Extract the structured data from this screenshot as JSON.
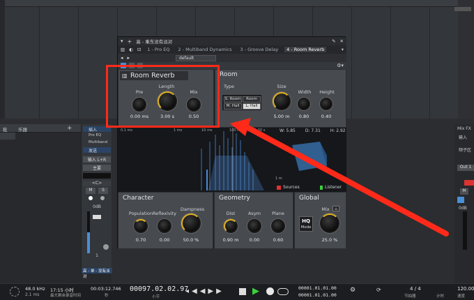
{
  "daw": {
    "tracks_header": "乐器",
    "track_left_label": "批",
    "track_name_strip": "高 - 单 - 没有派对",
    "plus_symbol": "+",
    "mixer_strip": {
      "inserts_label": "插入",
      "insert_items": [
        "Pro EQ",
        "Multiband"
      ],
      "sends_label": "发送",
      "input_label": "输入 L+R",
      "output_label": "主要",
      "pan_label": "<C>",
      "mute": "M",
      "solo": "S",
      "volume": "0dB",
      "channel_number": "1"
    },
    "right_strip": {
      "header": "Mix FX",
      "inserts_label": "输入",
      "group_label": "频子区",
      "out_label": "Out 1",
      "volume": "0dB",
      "mute": "M"
    }
  },
  "plugin": {
    "title": "高 - 乘东没有派对",
    "tabs": [
      "1 - Pro EQ",
      "2 - Multiband Dynamics",
      "3 - Groove Delay",
      "4 - Room Reverb"
    ],
    "active_tab": 3,
    "preset": "default",
    "room_reverb": {
      "name": "Room Reverb",
      "knobs": [
        {
          "label": "Pre",
          "value": "0.00 ms"
        },
        {
          "label": "Length",
          "value": "3.00 s"
        },
        {
          "label": "Mix",
          "value": "0.50"
        }
      ]
    },
    "room": {
      "title": "Room",
      "type_label": "Type",
      "types": [
        "S. Room",
        "Room",
        "M. Hall",
        "L. Hall"
      ],
      "active_type": "L. Hall",
      "knobs": [
        {
          "label": "Size",
          "value": "5.00 m"
        },
        {
          "label": "Width",
          "value": "0.80"
        },
        {
          "label": "Height",
          "value": "0.40"
        }
      ]
    },
    "viz": {
      "time_marks": [
        "0.1 ms",
        "1 ms",
        "10 ms",
        "100 ms",
        "1.00 s"
      ],
      "dims": [
        "W: 5.85",
        "D: 7.31",
        "H: 2.92"
      ],
      "sources_label": "Sources",
      "listener_label": "Listener",
      "distance_marker": "1 m"
    },
    "character": {
      "title": "Character",
      "knobs": [
        {
          "label": "Population",
          "value": "0.70"
        },
        {
          "label": "Reflexivity",
          "value": "0.00"
        },
        {
          "label": "Dampness",
          "value": "50.0 %"
        }
      ]
    },
    "geometry": {
      "title": "Geometry",
      "knobs": [
        {
          "label": "Dist",
          "value": "0.90 m"
        },
        {
          "label": "Asym",
          "value": "0.00"
        },
        {
          "label": "Plane",
          "value": "0.60"
        }
      ]
    },
    "global": {
      "title": "Global",
      "hq_label": "HQ",
      "mode_label": "Mode",
      "mix_label": "Mix",
      "mix_value": "25.0 %"
    }
  },
  "transport": {
    "sample_rate": "48.0 kHz",
    "latency": "2.1 ms",
    "record_time": "17:15 小时",
    "record_time_label": "最大剩余录音时间",
    "duration": "00:03:12.746",
    "duration_label": "秒",
    "position": "00097.02.02.97",
    "position_label": "小节",
    "loop_start": "00001.01.01.00",
    "loop_end": "00001.01.01.00",
    "time_sig": "4 / 4",
    "time_sig_label": "节拍器",
    "timing_label": "计时",
    "tempo": "120.00",
    "tempo_label": "速度"
  },
  "colors": {
    "accent_blue": "#4b8fd6",
    "knob_ring": "#e0b020",
    "highlight_red": "#ff2a1a",
    "play_green": "#3bd13b",
    "room_box": "#4a90c8"
  }
}
